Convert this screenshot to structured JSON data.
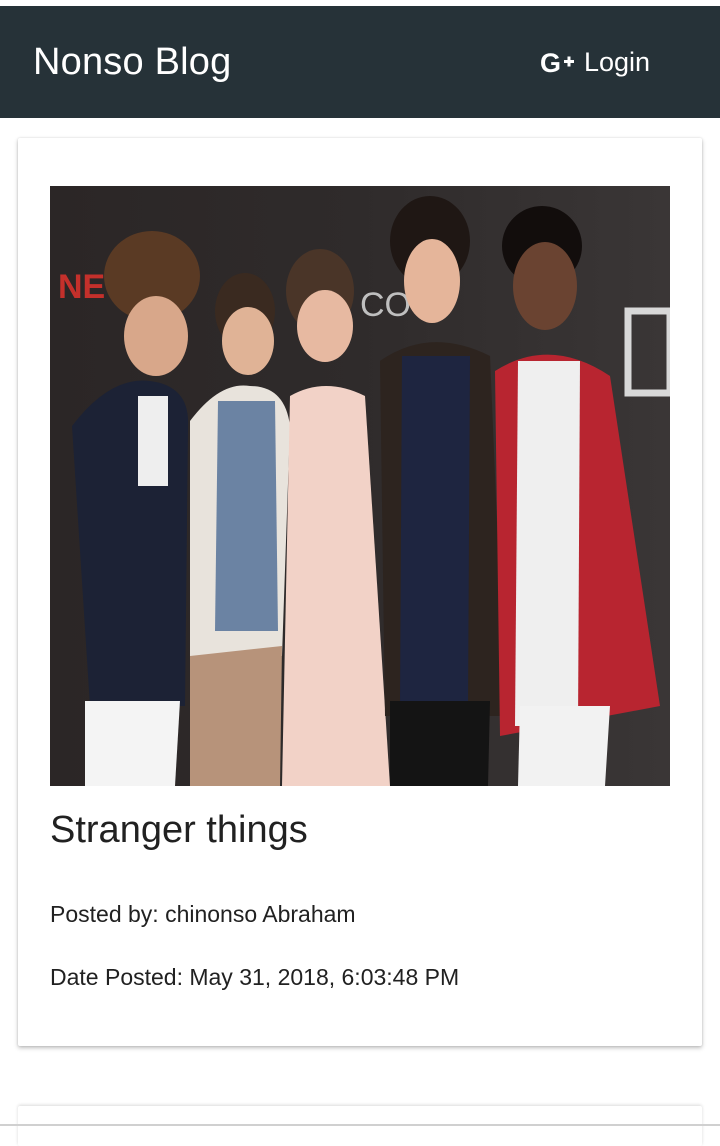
{
  "app_bar": {
    "title": "Nonso Blog",
    "login_label": "Login",
    "login_icon": "google-plus-icon",
    "background_color": "#263238"
  },
  "posts": [
    {
      "title": "Stranger things",
      "author_text": "Posted by: chinonso Abraham",
      "date_text": "Date Posted: May 31, 2018, 6:03:48 PM",
      "image_sign_text": "NETFL",
      "image_sign_text_2": "CO      O"
    }
  ]
}
